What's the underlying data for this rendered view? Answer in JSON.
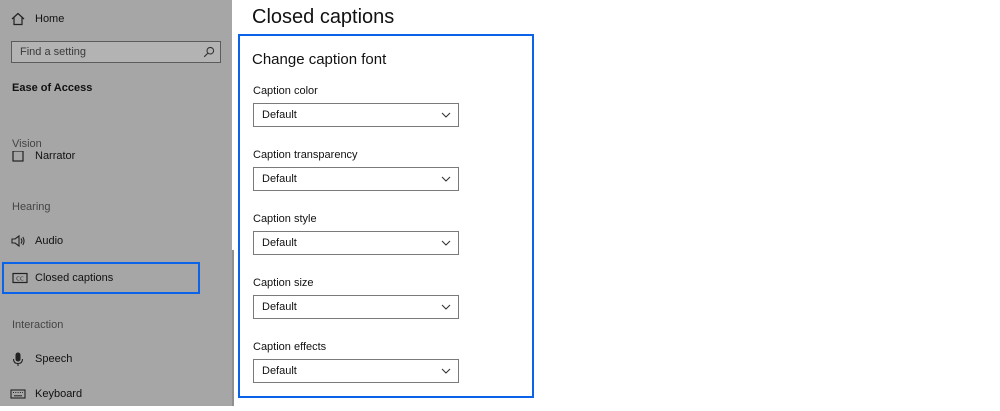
{
  "sidebar": {
    "home_label": "Home",
    "search": {
      "placeholder": "Find a setting",
      "value": ""
    },
    "section_title": "Ease of Access",
    "groups": [
      {
        "header": "Vision",
        "items": [
          {
            "label": "Narrator",
            "icon": "narrator-icon"
          }
        ]
      },
      {
        "header": "Hearing",
        "items": [
          {
            "label": "Audio",
            "icon": "speaker-icon"
          },
          {
            "label": "Closed captions",
            "icon": "closed-captions-icon",
            "selected": true
          }
        ]
      },
      {
        "header": "Interaction",
        "items": [
          {
            "label": "Speech",
            "icon": "microphone-icon"
          },
          {
            "label": "Keyboard",
            "icon": "keyboard-icon"
          }
        ]
      }
    ]
  },
  "main": {
    "title": "Closed captions",
    "panel": {
      "title": "Change caption font",
      "fields": [
        {
          "label": "Caption color",
          "value": "Default"
        },
        {
          "label": "Caption transparency",
          "value": "Default"
        },
        {
          "label": "Caption style",
          "value": "Default"
        },
        {
          "label": "Caption size",
          "value": "Default"
        },
        {
          "label": "Caption effects",
          "value": "Default"
        }
      ]
    }
  },
  "colors": {
    "highlight": "#0a63e8",
    "sidebar_bg": "#a6a6a6"
  }
}
